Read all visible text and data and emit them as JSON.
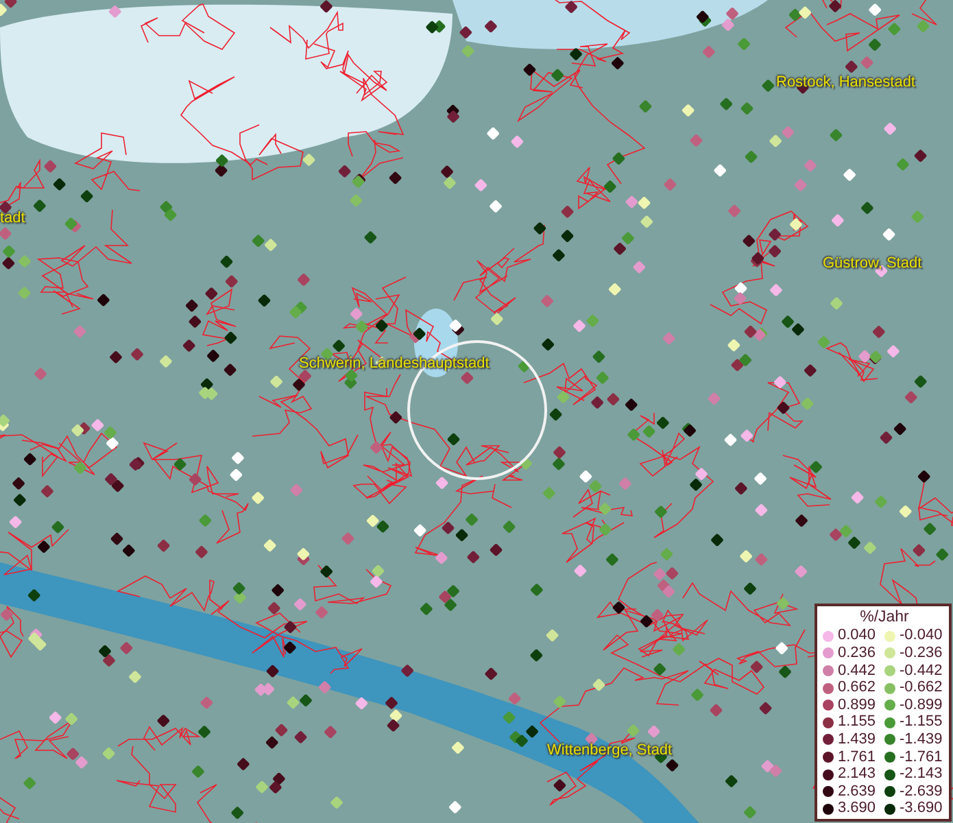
{
  "map": {
    "places": [
      {
        "name": "Rostock, Hansestadt"
      },
      {
        "name": "tadt"
      },
      {
        "name": "Güstrow, Stadt"
      },
      {
        "name": "Schwerin, Landeshauptstadt"
      },
      {
        "name": "Wittenberge, Stadt"
      }
    ]
  },
  "legend": {
    "title": "%/Jahr",
    "rows": [
      {
        "positive": {
          "value": "0.040",
          "color": "#f5b8e8"
        },
        "negative": {
          "value": "-0.040",
          "color": "#eef5b0"
        }
      },
      {
        "positive": {
          "value": "0.236",
          "color": "#e39ccd"
        },
        "negative": {
          "value": "-0.236",
          "color": "#cfe59a"
        }
      },
      {
        "positive": {
          "value": "0.442",
          "color": "#d07fa8"
        },
        "negative": {
          "value": "-0.442",
          "color": "#a9d47e"
        }
      },
      {
        "positive": {
          "value": "0.662",
          "color": "#c0607f"
        },
        "negative": {
          "value": "-0.662",
          "color": "#86c062"
        }
      },
      {
        "positive": {
          "value": "0.899",
          "color": "#a84460"
        },
        "negative": {
          "value": "-0.899",
          "color": "#65ad4a"
        }
      },
      {
        "positive": {
          "value": "1.155",
          "color": "#8c2f45"
        },
        "negative": {
          "value": "-1.155",
          "color": "#4a9a38"
        }
      },
      {
        "positive": {
          "value": "1.439",
          "color": "#72203a"
        },
        "negative": {
          "value": "-1.439",
          "color": "#38852c"
        }
      },
      {
        "positive": {
          "value": "1.761",
          "color": "#5c1428"
        },
        "negative": {
          "value": "-1.761",
          "color": "#256e20"
        }
      },
      {
        "positive": {
          "value": "2.143",
          "color": "#460c1c"
        },
        "negative": {
          "value": "-2.143",
          "color": "#175616"
        }
      },
      {
        "positive": {
          "value": "2.639",
          "color": "#320812"
        },
        "negative": {
          "value": "-2.639",
          "color": "#0e400e"
        }
      },
      {
        "positive": {
          "value": "3.690",
          "color": "#1e040a"
        },
        "negative": {
          "value": "-3.690",
          "color": "#082a08"
        }
      }
    ]
  }
}
